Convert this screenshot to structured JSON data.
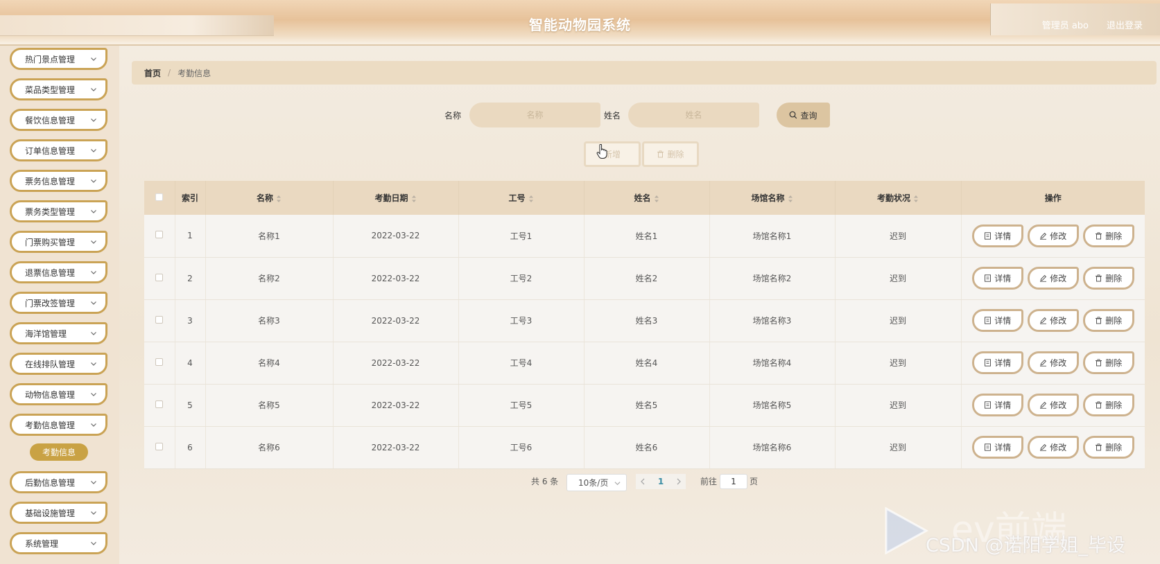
{
  "header": {
    "title": "智能动物园系统",
    "user_label": "管理员 abo",
    "logout_label": "退出登录"
  },
  "sidebar": {
    "items": [
      {
        "label": "热门景点管理"
      },
      {
        "label": "菜品类型管理"
      },
      {
        "label": "餐饮信息管理"
      },
      {
        "label": "订单信息管理"
      },
      {
        "label": "票务信息管理"
      },
      {
        "label": "票务类型管理"
      },
      {
        "label": "门票购买管理"
      },
      {
        "label": "退票信息管理"
      },
      {
        "label": "门票改签管理"
      },
      {
        "label": "海洋馆管理"
      },
      {
        "label": "在线排队管理"
      },
      {
        "label": "动物信息管理"
      },
      {
        "label": "考勤信息管理"
      },
      {
        "label": "后勤信息管理"
      },
      {
        "label": "基础设施管理"
      },
      {
        "label": "系统管理"
      }
    ],
    "active_sub": "考勤信息"
  },
  "breadcrumb": {
    "home": "首页",
    "separator": "/",
    "current": "考勤信息"
  },
  "search": {
    "name_label": "名称",
    "name_placeholder": "名称",
    "person_label": "姓名",
    "person_placeholder": "姓名",
    "query_label": "查询"
  },
  "toolbar": {
    "add_label": "新增",
    "delete_label": "删除"
  },
  "table": {
    "headers": {
      "index": "索引",
      "name": "名称",
      "date": "考勤日期",
      "job_no": "工号",
      "person": "姓名",
      "venue": "场馆名称",
      "status": "考勤状况",
      "ops": "操作"
    },
    "rows": [
      {
        "index": "1",
        "name": "名称1",
        "date": "2022-03-22",
        "job_no": "工号1",
        "person": "姓名1",
        "venue": "场馆名称1",
        "status": "迟到"
      },
      {
        "index": "2",
        "name": "名称2",
        "date": "2022-03-22",
        "job_no": "工号2",
        "person": "姓名2",
        "venue": "场馆名称2",
        "status": "迟到"
      },
      {
        "index": "3",
        "name": "名称3",
        "date": "2022-03-22",
        "job_no": "工号3",
        "person": "姓名3",
        "venue": "场馆名称3",
        "status": "迟到"
      },
      {
        "index": "4",
        "name": "名称4",
        "date": "2022-03-22",
        "job_no": "工号4",
        "person": "姓名4",
        "venue": "场馆名称4",
        "status": "迟到"
      },
      {
        "index": "5",
        "name": "名称5",
        "date": "2022-03-22",
        "job_no": "工号5",
        "person": "姓名5",
        "venue": "场馆名称5",
        "status": "迟到"
      },
      {
        "index": "6",
        "name": "名称6",
        "date": "2022-03-22",
        "job_no": "工号6",
        "person": "姓名6",
        "venue": "场馆名称6",
        "status": "迟到"
      }
    ],
    "actions": {
      "detail": "详情",
      "edit": "修改",
      "delete": "删除"
    }
  },
  "pagination": {
    "total_label": "共 6 条",
    "page_size": "10条/页",
    "current_page": "1",
    "goto_label": "前往",
    "goto_value": "1",
    "page_suffix": "页"
  },
  "watermark": {
    "brand": "ev前端",
    "text": "CSDN @诺阳学姐_毕设"
  },
  "colors": {
    "accent": "#c9a244",
    "header_bg": "#e7c29a",
    "table_header_bg": "#ead9c1",
    "page_link": "#3b8ea5"
  }
}
